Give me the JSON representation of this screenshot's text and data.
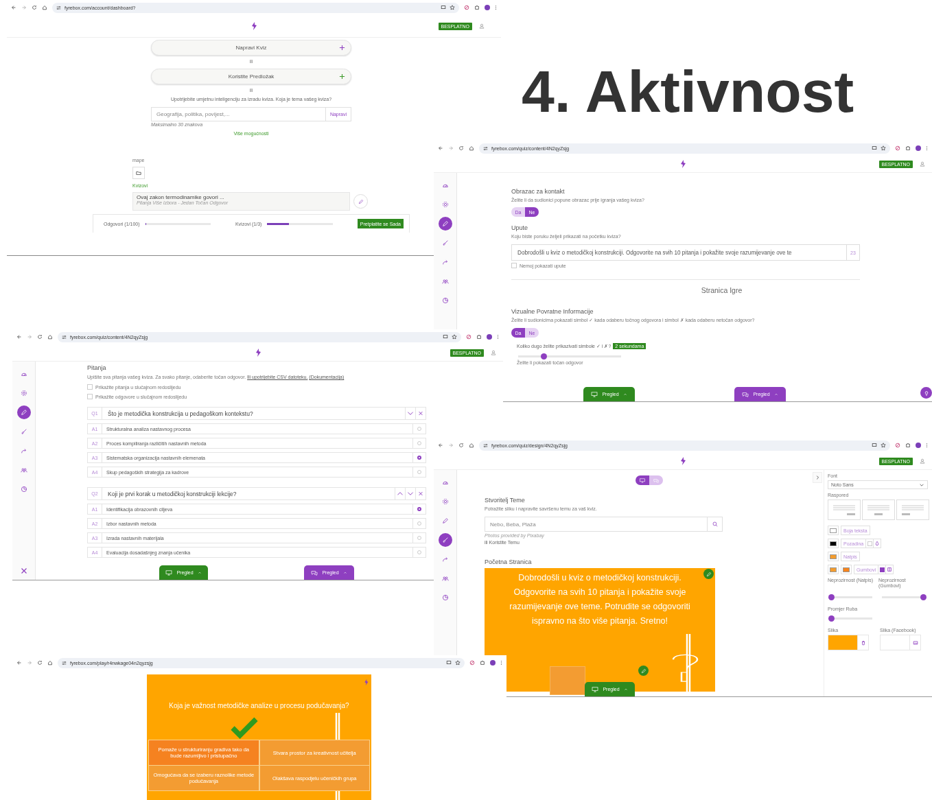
{
  "slide_title": "4. Aktivnost",
  "dashboard_window": {
    "url": "fyrebox.com/account/dashboard?",
    "badge": "BESPLATNO",
    "create_button": "Napravi Kviz",
    "separator_1": "ili",
    "template_button": "Koristite Predložak",
    "separator_2": "ili",
    "ai_prompt": "Upotrijebite umjetnu inteligenciju za izradu kviza. Koja je tema vašeg kviza?",
    "topic_field": {
      "placeholder": "Geografija, politika, povijest,...",
      "button": "Napravi",
      "hint": "Maksimalno 30 znakova"
    },
    "more_link": "Više mogućnosti",
    "folders_label": "mape",
    "quizzes_label": "Kvizovi",
    "quiz": {
      "title": "Ovaj zakon termodinamike govori ...",
      "subtitle": "Pitanja Više Izbora - Jedan Točan Odgovor"
    },
    "usage": [
      {
        "label": "Odgovori (1/100)",
        "level": 0.01
      },
      {
        "label": "Kvizovi (1/3)",
        "level": 0.33
      }
    ],
    "subscribe_button": "Pretplatite se Sada"
  },
  "content_window": {
    "url": "fyrebox.com/quiz/content/4N2qyZsjg",
    "badge": "BESPLATNO",
    "sidebar": [
      {
        "selected": false
      },
      {
        "selected": false
      },
      {
        "selected": true
      },
      {
        "selected": false
      },
      {
        "selected": false
      },
      {
        "selected": false
      },
      {
        "selected": false
      }
    ],
    "contact": {
      "title": "Obrazac za kontakt",
      "question": "Želite li da sudionici popune obrazac prije igranja vašeg kviza?",
      "options": [
        {
          "label": "Da",
          "selected": false
        },
        {
          "label": "Ne",
          "selected": true
        }
      ]
    },
    "instructions": {
      "title": "Upute",
      "question": "Koju biste poruku željeli prikazati na početku kviza?",
      "value": "Dobrodošli u kviz o metodičkoj konstrukciji. Odgovorite na svih 10 pitanja i pokažite svoje razumijevanje ove te",
      "counter": "23",
      "checkbox": {
        "label": "Nemoj pokazati upute",
        "checked": false
      }
    },
    "page_heading": "Stranica Igre",
    "feedback": {
      "title": "Vizualne Povratne Informacije",
      "question": "Želite li sudionicima pokazati simbol ✓ kada odaberu točnog odgovora i simbol ✗ kada odaberu netočan odgovor?",
      "options": [
        {
          "label": "Da",
          "selected": true
        },
        {
          "label": "Ne",
          "selected": false
        }
      ],
      "duration_label": "Koliko dugo želite prikazivati simbole ✓ i ✗?",
      "duration_badge": "2 sekundama",
      "duration_slider": {
        "level": 0.25
      },
      "next_question": "Želite li pokazati točan odgovor"
    },
    "preview_buttons": [
      {
        "kind": "desktop",
        "label": "Pregled"
      },
      {
        "kind": "chat",
        "label": "Pregled"
      }
    ]
  },
  "questions_window": {
    "url": "fyrebox.com/quiz/content/4N2qyZsjg",
    "badge": "BESPLATNO",
    "sidebar": [
      {
        "selected": false
      },
      {
        "selected": false
      },
      {
        "selected": true
      },
      {
        "selected": false
      },
      {
        "selected": false
      },
      {
        "selected": false
      },
      {
        "selected": false
      }
    ],
    "title": "Pitanja",
    "intro": "Upišite sva pitanja vašeg kviza. Za svako pitanje, odaberite točan odgovor.",
    "csv_link": "Ili upotrijebite CSV datoteku.",
    "docs_link": "(Dokumentacija)",
    "options": [
      {
        "label": "Prikažite pitanja u slučajnom redoslijedu",
        "checked": false
      },
      {
        "label": "Prikažite odgovore u slučajnom redoslijedu",
        "checked": false
      }
    ],
    "questions": [
      {
        "number": "Q1",
        "text": "Što je metodička konstrukcija u pedagoškom kontekstu?",
        "answers": [
          {
            "number": "A1",
            "text": "Strukturalna analiza nastavnog procesa",
            "selected": false
          },
          {
            "number": "A2",
            "text": "Proces kompiliranja različitih nastavnih metoda",
            "selected": false
          },
          {
            "number": "A3",
            "text": "Sistematska organizacija nastavnih elemenata",
            "selected": true
          },
          {
            "number": "A4",
            "text": "Skup pedagoških strategija za kadrove",
            "selected": false
          }
        ]
      },
      {
        "number": "Q2",
        "text": "Koji je prvi korak u metodičkoj konstrukciji lekcije?",
        "answers": [
          {
            "number": "A1",
            "text": "Identifikacija obrazovnih ciljeva",
            "selected": true
          },
          {
            "number": "A2",
            "text": "Izbor nastavnih metoda",
            "selected": false
          },
          {
            "number": "A3",
            "text": "Izrada nastavnih materijala",
            "selected": false
          },
          {
            "number": "A4",
            "text": "Evaluacija dosadašnjeg znanja učenika",
            "selected": false
          }
        ]
      }
    ],
    "preview_buttons": [
      {
        "kind": "desktop",
        "label": "Pregled"
      },
      {
        "kind": "chat",
        "label": "Pregled"
      }
    ]
  },
  "design_window": {
    "url": "fyrebox.com/quiz/design/4N2qyZsjg",
    "badge": "BESPLATNO",
    "sidebar": [
      {
        "selected": false
      },
      {
        "selected": false
      },
      {
        "selected": false
      },
      {
        "selected": true
      },
      {
        "selected": false
      },
      {
        "selected": false
      },
      {
        "selected": false
      }
    ],
    "device_toggle": [
      {
        "kind": "desktop",
        "selected": true
      },
      {
        "kind": "chat",
        "selected": false
      }
    ],
    "theme": {
      "title": "Stvoritelj Teme",
      "description": "Potražite sliku i napravite savršenu temu za vaš kviz.",
      "search_placeholder": "Nebo, Beba, Plaža",
      "credit": "Photos provided by Pixabay",
      "alternative": "ili Koristite Temu"
    },
    "start": {
      "title": "Početna Stranica",
      "welcome": "Dobrodošli u kviz o metodičkoj konstrukciji. Odgovorite na svih 10 pitanja i pokažite svoje razumijevanje ove teme. Potrudite se odgovoriti ispravno na što više pitanja. Sretno!"
    },
    "panel": {
      "font_label": "Font",
      "font_value": "Noto Sans",
      "layout_label": "Raspored",
      "colors": [
        {
          "label": "Boja teksta",
          "swatches": [
            {
              "color": "#ffffff"
            }
          ]
        },
        {
          "label": "Pozadina",
          "swatches": [
            {
              "color": "#000000"
            }
          ],
          "checkbox": {
            "checked": false
          }
        },
        {
          "label": "Natpis",
          "swatches": [
            {
              "color": "#f39c2f"
            }
          ]
        },
        {
          "label": "Gumbovi",
          "swatches": [
            {
              "color": "#f39c2f"
            },
            {
              "color": "#f7841c"
            }
          ],
          "checkbox": {
            "checked": true
          }
        }
      ],
      "opacity": [
        {
          "label": "Neprozirnost (Natpis)",
          "level": 0
        },
        {
          "label": "Neprozirnost (Gumbovi)",
          "level": 1
        }
      ],
      "border": {
        "label": "Promjer Ruba",
        "level": 0
      },
      "images": [
        {
          "label": "Slika",
          "color": "#ffa500"
        },
        {
          "label": "Slika (Facebook)"
        }
      ]
    },
    "preview_buttons": [
      {
        "kind": "desktop",
        "label": "Pregled"
      }
    ]
  },
  "play_window": {
    "url": "fyrebox.com/play/r4nwkage04n2qyzsjg",
    "question": "Koja je važnost metodičke analize u procesu podučavanja?",
    "answers": [
      {
        "text": "Pomaže u strukturiranju gradiva tako da bude razumljivo i pristupačno",
        "selected": true
      },
      {
        "text": "Stvara prostor za kreativnost učitelja",
        "selected": false
      },
      {
        "text": "Omogućava da se izaberu raznolike metode podučavanja",
        "selected": false
      },
      {
        "text": "Olakšava raspodjelu učeničkih grupa",
        "selected": false
      }
    ]
  }
}
